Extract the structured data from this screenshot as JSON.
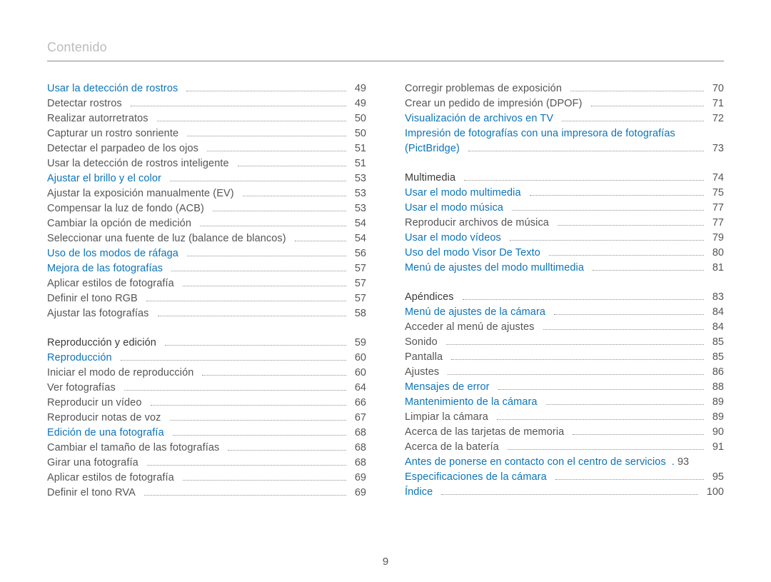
{
  "page_title": "Contenido",
  "page_number": "9",
  "left": [
    {
      "label": "Usar la detección de rostros",
      "page": "49",
      "style": "link"
    },
    {
      "label": "Detectar rostros",
      "page": "49",
      "style": "plain"
    },
    {
      "label": "Realizar autorretratos",
      "page": "50",
      "style": "plain"
    },
    {
      "label": "Capturar un rostro sonriente",
      "page": "50",
      "style": "plain"
    },
    {
      "label": "Detectar el parpadeo de los ojos",
      "page": "51",
      "style": "plain"
    },
    {
      "label": "Usar la detección de rostros inteligente",
      "page": "51",
      "style": "plain"
    },
    {
      "label": "Ajustar el brillo y el color",
      "page": "53",
      "style": "link"
    },
    {
      "label": "Ajustar la exposición manualmente (EV)",
      "page": "53",
      "style": "plain"
    },
    {
      "label": "Compensar la luz de fondo (ACB)",
      "page": "53",
      "style": "plain"
    },
    {
      "label": "Cambiar la opción de medición",
      "page": "54",
      "style": "plain"
    },
    {
      "label": "Seleccionar una fuente de luz (balance de blancos)",
      "page": "54",
      "style": "plain"
    },
    {
      "label": "Uso de los modos de ráfaga",
      "page": "56",
      "style": "link"
    },
    {
      "label": "Mejora de las fotografías",
      "page": "57",
      "style": "link"
    },
    {
      "label": "Aplicar estilos de fotografía",
      "page": "57",
      "style": "plain"
    },
    {
      "label": "Definir el tono RGB",
      "page": "57",
      "style": "plain"
    },
    {
      "label": "Ajustar las fotografías",
      "page": "58",
      "style": "plain"
    },
    {
      "spacer": true
    },
    {
      "label": "Reproducción y edición",
      "page": "59",
      "style": "bold"
    },
    {
      "label": "Reproducción",
      "page": "60",
      "style": "link"
    },
    {
      "label": "Iniciar el modo de reproducción",
      "page": "60",
      "style": "plain"
    },
    {
      "label": "Ver fotografías",
      "page": "64",
      "style": "plain"
    },
    {
      "label": "Reproducir un vídeo",
      "page": "66",
      "style": "plain"
    },
    {
      "label": "Reproducir notas de voz",
      "page": "67",
      "style": "plain"
    },
    {
      "label": "Edición de una fotografía",
      "page": "68",
      "style": "link"
    },
    {
      "label": "Cambiar el tamaño de las fotografías",
      "page": "68",
      "style": "plain"
    },
    {
      "label": "Girar una fotografía",
      "page": "68",
      "style": "plain"
    },
    {
      "label": "Aplicar estilos de fotografía",
      "page": "69",
      "style": "plain"
    },
    {
      "label": "Definir el tono RVA",
      "page": "69",
      "style": "plain"
    }
  ],
  "right": [
    {
      "label": "Corregir problemas de exposición",
      "page": "70",
      "style": "plain"
    },
    {
      "label": "Crear un pedido de impresión (DPOF)",
      "page": "71",
      "style": "plain"
    },
    {
      "label": "Visualización de archivos en TV",
      "page": "72",
      "style": "link"
    },
    {
      "label": "Impresión de fotografías con una impresora de fotografías",
      "style": "link",
      "nodots": true
    },
    {
      "label": "(PictBridge)",
      "page": "73",
      "style": "link"
    },
    {
      "spacer": true
    },
    {
      "label": "Multimedia",
      "page": "74",
      "style": "bold"
    },
    {
      "label": "Usar el modo multimedia",
      "page": "75",
      "style": "link"
    },
    {
      "label": "Usar el modo música",
      "page": "77",
      "style": "link"
    },
    {
      "label": "Reproducir archivos de música",
      "page": "77",
      "style": "plain"
    },
    {
      "label": "Usar el modo vídeos",
      "page": "79",
      "style": "link"
    },
    {
      "label": "Uso del modo Visor De Texto",
      "page": "80",
      "style": "link"
    },
    {
      "label": "Menú de ajustes del modo mulltimedia",
      "page": "81",
      "style": "link"
    },
    {
      "spacer": true
    },
    {
      "label": "Apéndices",
      "page": "83",
      "style": "bold"
    },
    {
      "label": "Menú de ajustes de la cámara",
      "page": "84",
      "style": "link"
    },
    {
      "label": "Acceder al menú de ajustes",
      "page": "84",
      "style": "plain"
    },
    {
      "label": "Sonido",
      "page": "85",
      "style": "plain"
    },
    {
      "label": "Pantalla",
      "page": "85",
      "style": "plain"
    },
    {
      "label": "Ajustes",
      "page": "86",
      "style": "plain"
    },
    {
      "label": "Mensajes de error",
      "page": "88",
      "style": "link"
    },
    {
      "label": "Mantenimiento de la cámara",
      "page": "89",
      "style": "link"
    },
    {
      "label": "Limpiar la cámara",
      "page": "89",
      "style": "plain"
    },
    {
      "label": "Acerca de las tarjetas de memoria",
      "page": "90",
      "style": "plain"
    },
    {
      "label": "Acerca de la batería",
      "page": "91",
      "style": "plain"
    },
    {
      "label": "Antes de ponerse en contacto con el centro de servicios",
      "page": "93",
      "style": "link",
      "sep": "."
    },
    {
      "label": "Especificaciones de la cámara",
      "page": "95",
      "style": "link"
    },
    {
      "label": "Índice",
      "page": "100",
      "style": "link"
    }
  ]
}
